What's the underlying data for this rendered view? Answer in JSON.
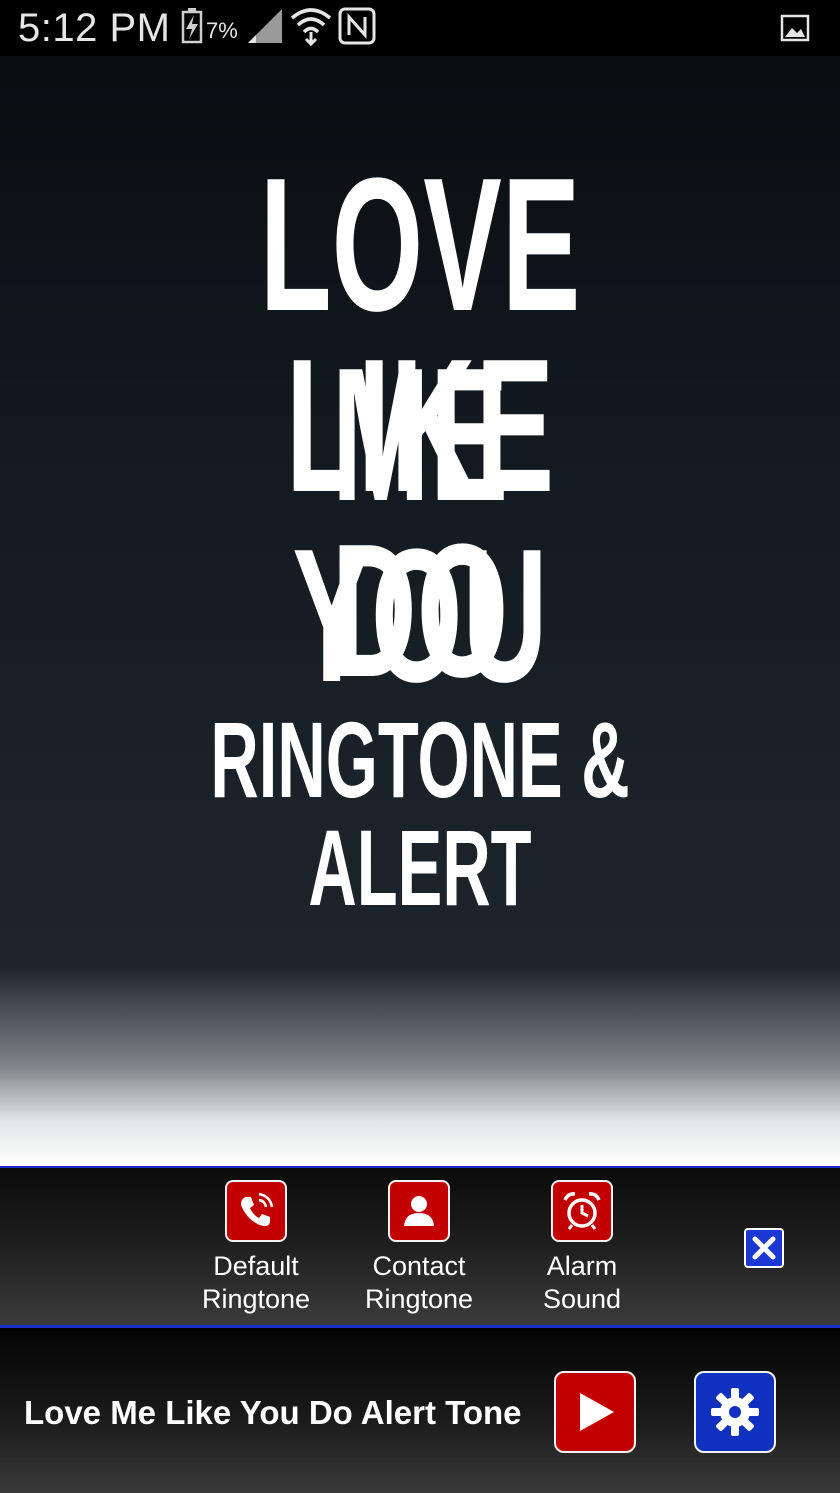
{
  "status_bar": {
    "time": "5:12 PM",
    "battery_percent": "7%",
    "icons": [
      "battery-charging-icon",
      "signal-icon",
      "wifi-icon",
      "nfc-icon",
      "gallery-icon"
    ]
  },
  "hero": {
    "title_lines": [
      "LOVE ME",
      "LIKE YOU",
      "DO"
    ],
    "subtitle": "RINGTONE & ALERT"
  },
  "actions": [
    {
      "label": "Default\nRingtone",
      "icon": "phone-icon"
    },
    {
      "label": "Contact\nRingtone",
      "icon": "contact-icon"
    },
    {
      "label": "Alarm\nSound",
      "icon": "alarm-clock-icon"
    }
  ],
  "bottom_bar": {
    "title": "Love Me Like You Do Alert Tone"
  },
  "colors": {
    "accent_red": "#c30000",
    "accent_blue": "#1030c0",
    "divider_blue": "#1a2ec9"
  }
}
